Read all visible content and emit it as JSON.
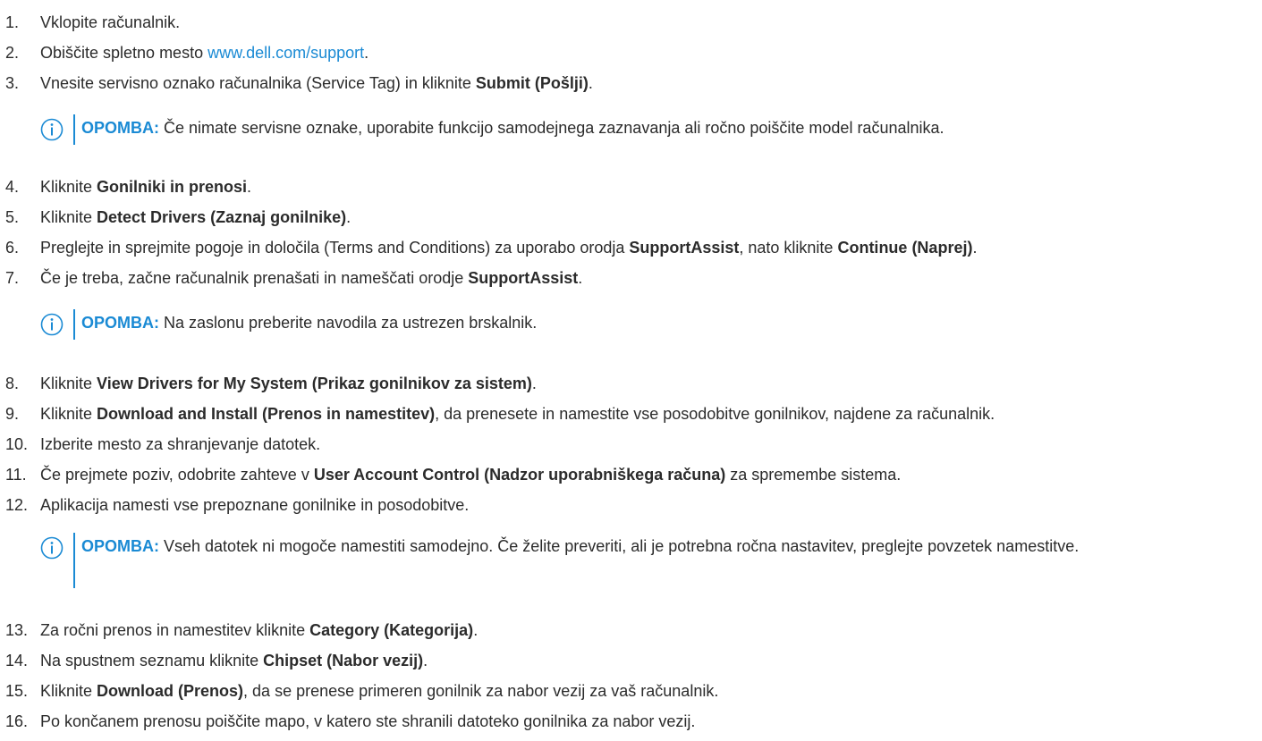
{
  "steps": [
    {
      "num": "1.",
      "parts": [
        {
          "t": "Vklopite računalnik."
        }
      ]
    },
    {
      "num": "2.",
      "parts": [
        {
          "t": "Obiščite spletno mesto "
        },
        {
          "t": "www.dell.com/support",
          "link": true
        },
        {
          "t": "."
        }
      ]
    },
    {
      "num": "3.",
      "parts": [
        {
          "t": "Vnesite servisno oznako računalnika (Service Tag) in kliknite "
        },
        {
          "t": "Submit (Pošlji)",
          "b": true
        },
        {
          "t": "."
        }
      ]
    },
    {
      "num": "4.",
      "parts": [
        {
          "t": "Kliknite "
        },
        {
          "t": "Gonilniki in prenosi",
          "b": true
        },
        {
          "t": "."
        }
      ]
    },
    {
      "num": "5.",
      "parts": [
        {
          "t": "Kliknite "
        },
        {
          "t": "Detect Drivers (Zaznaj gonilnike)",
          "b": true
        },
        {
          "t": "."
        }
      ]
    },
    {
      "num": "6.",
      "parts": [
        {
          "t": "Preglejte in sprejmite pogoje in določila (Terms and Conditions) za uporabo orodja "
        },
        {
          "t": "SupportAssist",
          "b": true
        },
        {
          "t": ", nato kliknite "
        },
        {
          "t": "Continue (Naprej)",
          "b": true
        },
        {
          "t": "."
        }
      ]
    },
    {
      "num": "7.",
      "parts": [
        {
          "t": "Če je treba, začne računalnik prenašati in nameščati orodje "
        },
        {
          "t": "SupportAssist",
          "b": true
        },
        {
          "t": "."
        }
      ]
    },
    {
      "num": "8.",
      "parts": [
        {
          "t": "Kliknite "
        },
        {
          "t": "View Drivers for My System (Prikaz gonilnikov za sistem)",
          "b": true
        },
        {
          "t": "."
        }
      ]
    },
    {
      "num": "9.",
      "parts": [
        {
          "t": "Kliknite "
        },
        {
          "t": "Download and Install (Prenos in namestitev)",
          "b": true
        },
        {
          "t": ", da prenesete in namestite vse posodobitve gonilnikov, najdene za računalnik."
        }
      ]
    },
    {
      "num": "10.",
      "parts": [
        {
          "t": "Izberite mesto za shranjevanje datotek."
        }
      ]
    },
    {
      "num": "11.",
      "parts": [
        {
          "t": "Če prejmete poziv, odobrite zahteve v "
        },
        {
          "t": "User Account Control (Nadzor uporabniškega računa)",
          "b": true
        },
        {
          "t": " za spremembe sistema."
        }
      ]
    },
    {
      "num": "12.",
      "parts": [
        {
          "t": "Aplikacija namesti vse prepoznane gonilnike in posodobitve."
        }
      ]
    },
    {
      "num": "13.",
      "parts": [
        {
          "t": "Za ročni prenos in namestitev kliknite "
        },
        {
          "t": "Category (Kategorija)",
          "b": true
        },
        {
          "t": "."
        }
      ]
    },
    {
      "num": "14.",
      "parts": [
        {
          "t": "Na spustnem seznamu kliknite "
        },
        {
          "t": "Chipset (Nabor vezij)",
          "b": true
        },
        {
          "t": "."
        }
      ]
    },
    {
      "num": "15.",
      "parts": [
        {
          "t": "Kliknite "
        },
        {
          "t": "Download (Prenos)",
          "b": true
        },
        {
          "t": ", da se prenese primeren gonilnik za nabor vezij za vaš računalnik."
        }
      ]
    },
    {
      "num": "16.",
      "parts": [
        {
          "t": "Po končanem prenosu poiščite mapo, v katero ste shranili datoteko gonilnika za nabor vezij."
        }
      ]
    }
  ],
  "notes": [
    {
      "label": "OPOMBA:",
      "text": " Če nimate servisne oznake, uporabite funkcijo samodejnega zaznavanja ali ročno poiščite model računalnika."
    },
    {
      "label": "OPOMBA:",
      "text": " Na zaslonu preberite navodila za ustrezen brskalnik."
    },
    {
      "label": "OPOMBA:",
      "text": " Vseh datotek ni mogoče namestiti samodejno. Če želite preveriti, ali je potrebna ročna nastavitev, preglejte povzetek namestitve."
    }
  ],
  "colors": {
    "accent": "#1a8ad4",
    "text": "#2b2b2b"
  }
}
